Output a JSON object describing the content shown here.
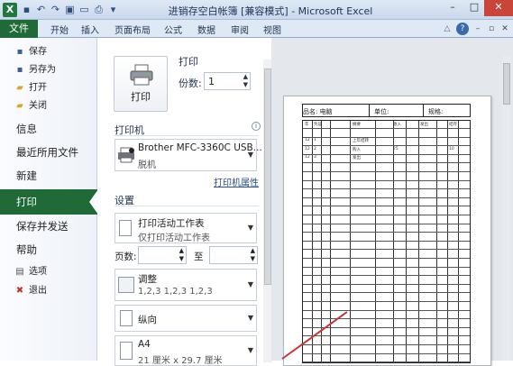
{
  "window": {
    "title": "进销存空白帐簿 [兼容模式] - Microsoft Excel",
    "app_letter": "X",
    "controls": [
      "–",
      "□",
      "✕"
    ]
  },
  "ribbon": {
    "file_tab": "文件",
    "tabs": [
      "开始",
      "插入",
      "页面布局",
      "公式",
      "数据",
      "审阅",
      "视图"
    ]
  },
  "backstage": {
    "items_small": [
      {
        "icon": "save-icon",
        "label": "保存"
      },
      {
        "icon": "save-as-icon",
        "label": "另存为"
      },
      {
        "icon": "open-folder-icon",
        "label": "打开"
      },
      {
        "icon": "close-document-icon",
        "label": "关闭"
      }
    ],
    "items_big": [
      "信息",
      "最近所用文件",
      "新建",
      "打印",
      "保存并发送",
      "帮助"
    ],
    "active": "打印",
    "items_bottom": [
      {
        "icon": "options-icon",
        "label": "选项"
      },
      {
        "icon": "exit-icon",
        "label": "退出"
      }
    ]
  },
  "print": {
    "section_title": "打印",
    "button_label": "打印",
    "copies_label": "份数:",
    "copies_value": "1",
    "printer_heading": "打印机",
    "printer_name": "Brother MFC-3360C USB...",
    "printer_status": "脱机",
    "printer_props_link": "打印机属性",
    "settings_heading": "设置",
    "scope_main": "打印活动工作表",
    "scope_sub": "仅打印活动工作表",
    "pages_label": "页数:",
    "pages_to": "至",
    "collate_main": "调整",
    "collate_sub": "1,2,3    1,2,3    1,2,3",
    "orientation": "纵向",
    "paper_main": "A4",
    "paper_sub": "21 厘米 x 29.7 厘米"
  },
  "preview": {
    "header_cells": [
      "品名: 电脑",
      "单位:",
      "规格:"
    ],
    "col_heads": [
      "年",
      "凭证",
      "摘要",
      "收入",
      "发出",
      "结存"
    ],
    "rows": [
      [
        "12",
        "1",
        "上年结转",
        "",
        "",
        ""
      ],
      [
        "12",
        "2",
        "购入",
        "25",
        "",
        "10"
      ],
      [
        "12",
        "3",
        "发出",
        "",
        "",
        ""
      ]
    ]
  },
  "colors": {
    "accent": "#1f6a36",
    "titlebar": "#dfe9f5",
    "preview_bg": "#e4e7ec"
  }
}
